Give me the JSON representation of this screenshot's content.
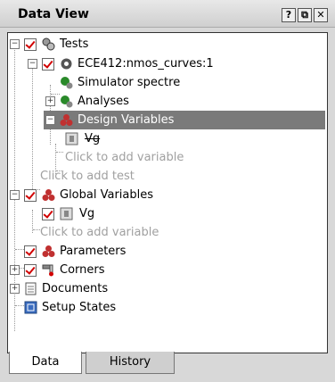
{
  "window": {
    "title": "Data View",
    "help_icon": "?",
    "float_icon": "⧉",
    "close_icon": "✕"
  },
  "tree": {
    "tests": "Tests",
    "test_name": "ECE412:nmos_curves:1",
    "simulator": "Simulator  spectre",
    "analyses": "Analyses",
    "design_variables": "Design Variables",
    "design_var_vg": "Vg",
    "click_add_variable_1": "Click to add variable",
    "click_add_test": "Click to add test",
    "global_variables": "Global Variables",
    "global_var_vg": "Vg",
    "click_add_variable_2": "Click to add variable",
    "parameters": "Parameters",
    "corners": "Corners",
    "documents": "Documents",
    "setup_states": "Setup States"
  },
  "tabs": {
    "data": "Data",
    "history": "History"
  },
  "colors": {
    "selected_row": "#7a7a7a",
    "check": "#d10000"
  }
}
